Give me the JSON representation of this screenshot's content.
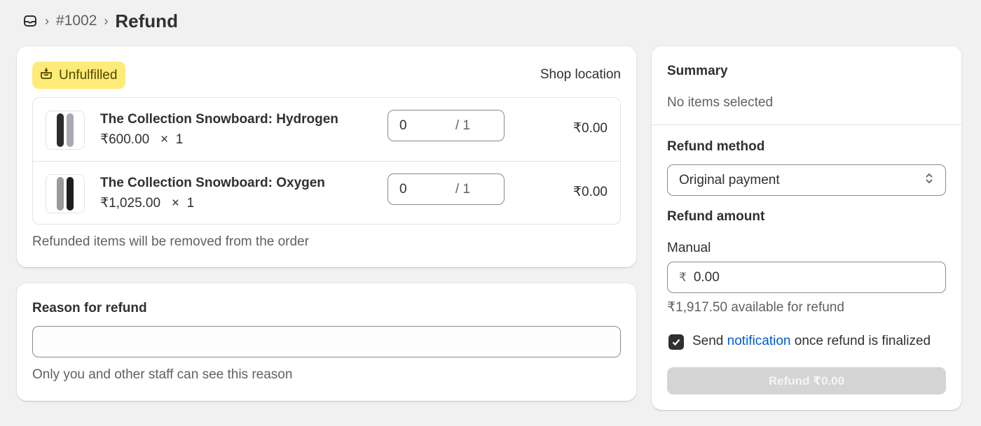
{
  "header": {
    "order_number": "#1002",
    "title": "Refund"
  },
  "items_card": {
    "status_badge": "Unfulfilled",
    "location": "Shop location",
    "items": [
      {
        "name": "The Collection Snowboard: Hydrogen",
        "price": "₹600.00",
        "multiply": "×",
        "ordered_qty": "1",
        "refund_qty": "0",
        "max_qty": "/ 1",
        "total": "₹0.00"
      },
      {
        "name": "The Collection Snowboard: Oxygen",
        "price": "₹1,025.00",
        "multiply": "×",
        "ordered_qty": "1",
        "refund_qty": "0",
        "max_qty": "/ 1",
        "total": "₹0.00"
      }
    ],
    "note": "Refunded items will be removed from the order"
  },
  "reason_card": {
    "title": "Reason for refund",
    "value": "",
    "help": "Only you and other staff can see this reason"
  },
  "summary": {
    "title": "Summary",
    "status": "No items selected",
    "method_label": "Refund method",
    "method_value": "Original payment",
    "amount_label": "Refund amount",
    "manual_label": "Manual",
    "currency_symbol": "₹",
    "amount_value": "0.00",
    "available": "₹1,917.50 available for refund",
    "notify_prefix": "Send",
    "notify_link": "notification",
    "notify_suffix": "once refund is finalized",
    "notify_checked": true,
    "refund_button": "Refund ₹0.00"
  },
  "colors": {
    "badge_bg": "#ffeb78",
    "link": "#005bd3",
    "disabled_button": "#d4d4d4"
  }
}
